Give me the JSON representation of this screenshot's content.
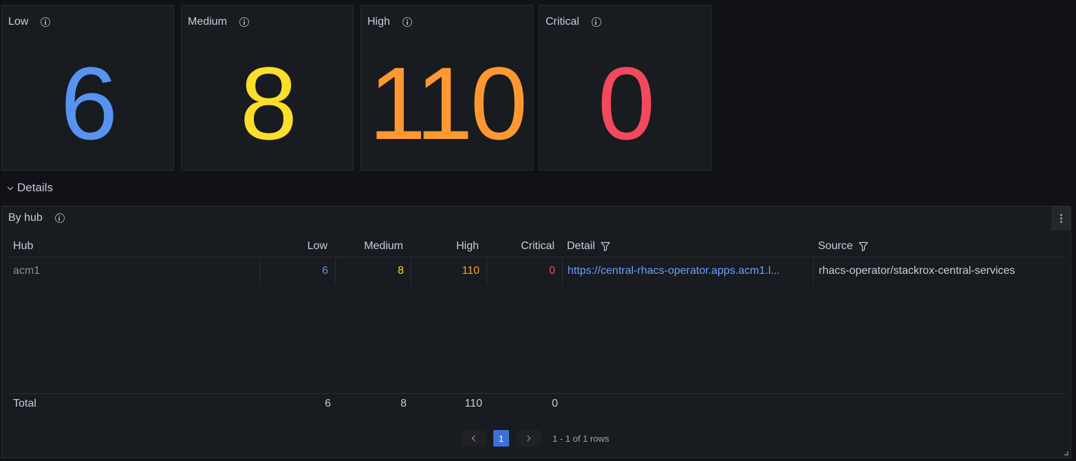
{
  "stats": [
    {
      "title": "Low",
      "value": "6",
      "color": "#5794f2"
    },
    {
      "title": "Medium",
      "value": "8",
      "color": "#fade2a"
    },
    {
      "title": "High",
      "value": "110",
      "color": "#ff9830"
    },
    {
      "title": "Critical",
      "value": "0",
      "color": "#f2495c"
    }
  ],
  "details_row": {
    "title": "Details"
  },
  "table_panel": {
    "title": "By hub",
    "columns": {
      "hub": "Hub",
      "low": "Low",
      "medium": "Medium",
      "high": "High",
      "critical": "Critical",
      "detail": "Detail",
      "source": "Source"
    },
    "rows": [
      {
        "hub": "acm1",
        "low": "6",
        "medium": "8",
        "high": "110",
        "critical": "0",
        "detail": "https://central-rhacs-operator.apps.acm1.l...",
        "source": "rhacs-operator/stackrox-central-services"
      }
    ],
    "footer": {
      "label": "Total",
      "low": "6",
      "medium": "8",
      "high": "110",
      "critical": "0"
    },
    "pagination": {
      "current_page": "1",
      "summary": "1 - 1 of 1 rows"
    }
  },
  "colors": {
    "low": "#5794f2",
    "medium": "#fade2a",
    "high": "#ff9830",
    "critical": "#f2495c",
    "link": "#6e9fff"
  }
}
